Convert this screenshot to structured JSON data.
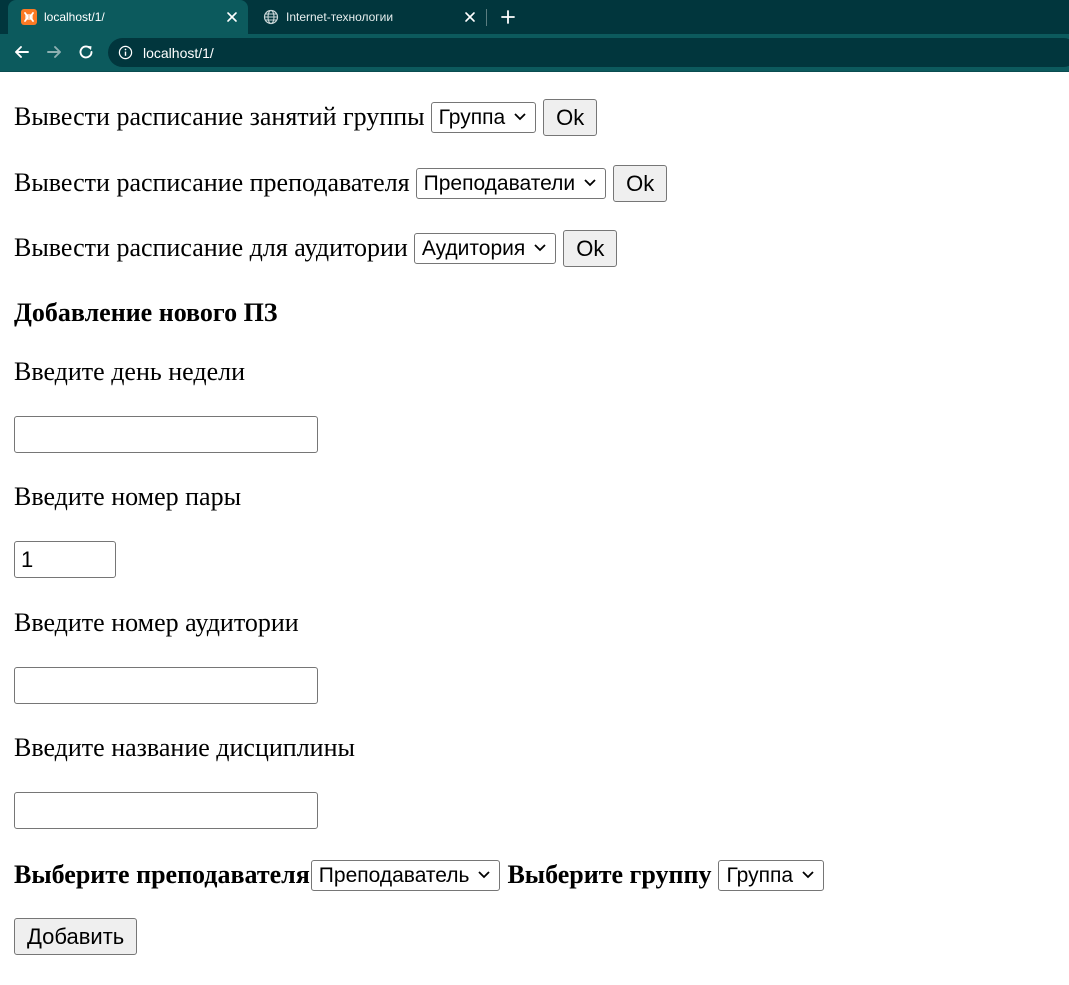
{
  "browser": {
    "tabs": [
      {
        "title": "localhost/1/",
        "icon": "xampp-favicon-icon",
        "active": true
      },
      {
        "title": "Internet-технологии",
        "icon": "globe-icon",
        "active": false
      }
    ],
    "address": "localhost/1/",
    "theme_color": "#0c5a5d",
    "tabstrip_color": "#01363d"
  },
  "schedule_group": {
    "label": "Вывести расписание занятий группы",
    "select_value": "Группа",
    "button": "Ok"
  },
  "schedule_teacher": {
    "label": "Вывести расписание преподавателя",
    "select_value": "Преподаватели",
    "button": "Ok"
  },
  "schedule_room": {
    "label": "Вывести расписание для аудитории",
    "select_value": "Аудитория",
    "button": "Ok"
  },
  "add_form": {
    "heading": "Добавление нового ПЗ",
    "day_label": "Введите день недели",
    "day_value": "",
    "pair_label": "Введите номер пары",
    "pair_value": "1",
    "room_label": "Введите номер аудитории",
    "room_value": "",
    "discipline_label": "Введите название дисциплины",
    "discipline_value": "",
    "teacher_label": "Выберите преподавателя",
    "teacher_select": "Преподаватель",
    "group_label": "Выберите группу",
    "group_select": "Группа",
    "submit": "Добавить"
  }
}
